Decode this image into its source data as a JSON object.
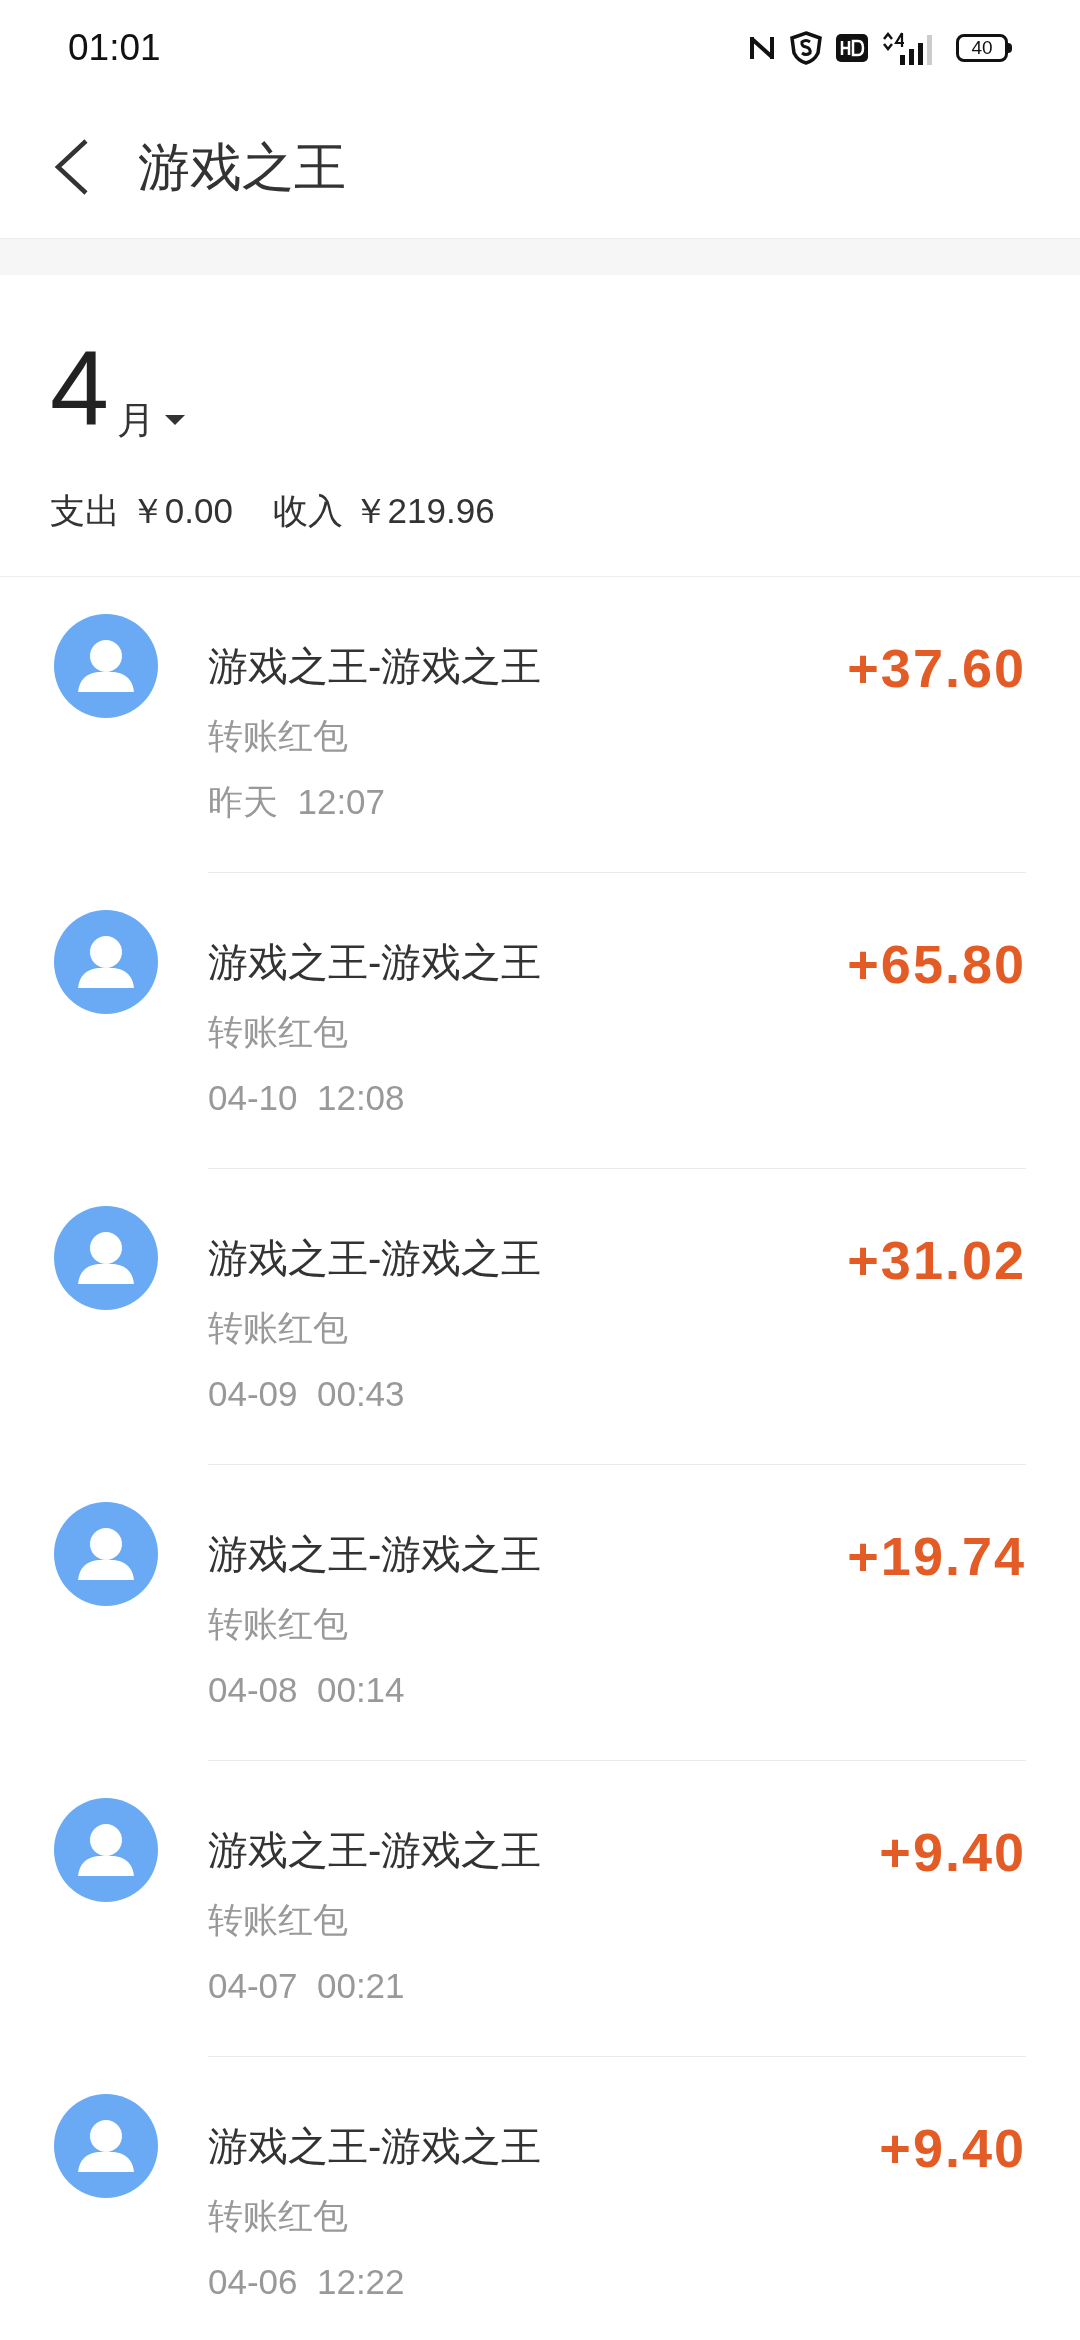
{
  "status_bar": {
    "time": "01:01",
    "battery": "40"
  },
  "header": {
    "title": "游戏之王"
  },
  "month": {
    "number": "4",
    "unit": "月"
  },
  "summary": {
    "expense_label": "支出",
    "expense": "￥0.00",
    "income_label": "收入",
    "income": "￥219.96"
  },
  "transactions": [
    {
      "title": "游戏之王-游戏之王",
      "type": "转账红包",
      "date": "昨天",
      "time": "12:07",
      "amount": "+37.60"
    },
    {
      "title": "游戏之王-游戏之王",
      "type": "转账红包",
      "date": "04-10",
      "time": "12:08",
      "amount": "+65.80"
    },
    {
      "title": "游戏之王-游戏之王",
      "type": "转账红包",
      "date": "04-09",
      "time": "00:43",
      "amount": "+31.02"
    },
    {
      "title": "游戏之王-游戏之王",
      "type": "转账红包",
      "date": "04-08",
      "time": "00:14",
      "amount": "+19.74"
    },
    {
      "title": "游戏之王-游戏之王",
      "type": "转账红包",
      "date": "04-07",
      "time": "00:21",
      "amount": "+9.40"
    },
    {
      "title": "游戏之王-游戏之王",
      "type": "转账红包",
      "date": "04-06",
      "time": "12:22",
      "amount": "+9.40"
    }
  ]
}
